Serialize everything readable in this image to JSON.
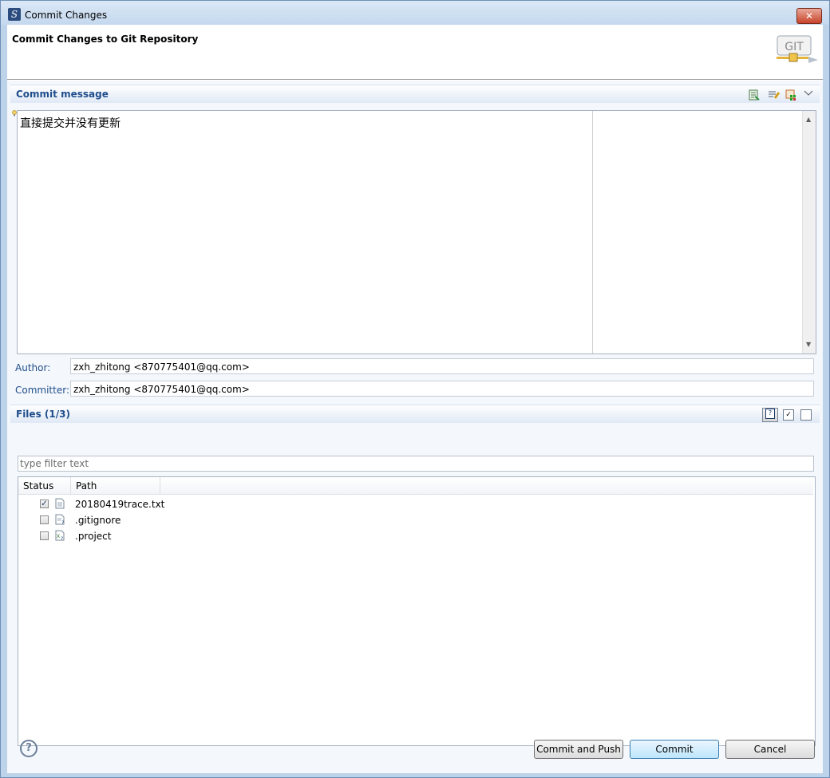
{
  "window": {
    "title": "Commit Changes"
  },
  "header": {
    "title": "Commit Changes to Git Repository",
    "logo_text": "GIT"
  },
  "commit_section": {
    "title": "Commit message",
    "message": "直接提交并没有更新",
    "toolbar_icons": [
      "previous-messages-icon",
      "format-message-icon",
      "add-signoff-icon",
      "view-menu-icon"
    ]
  },
  "author": {
    "label": "Author:",
    "value": "zxh_zhitong <870775401@qq.com>"
  },
  "committer": {
    "label": "Committer:",
    "value": "zxh_zhitong <870775401@qq.com>"
  },
  "files_section": {
    "title": "Files (1/3)",
    "filter_placeholder": "type filter text",
    "columns": [
      "Status",
      "Path"
    ],
    "files": [
      {
        "name": "20180419trace.txt",
        "checked": true,
        "icon": "text-file-icon"
      },
      {
        "name": ".gitignore",
        "checked": false,
        "icon": "untracked-file-icon"
      },
      {
        "name": ".project",
        "checked": false,
        "icon": "xml-file-icon"
      }
    ]
  },
  "buttons": {
    "commit_and_push": "Commit and Push",
    "commit": "Commit",
    "cancel": "Cancel"
  },
  "colors": {
    "section_title": "#1f4e8c",
    "window_frame": "#bcd3ea",
    "default_button": "#bee6fd"
  }
}
